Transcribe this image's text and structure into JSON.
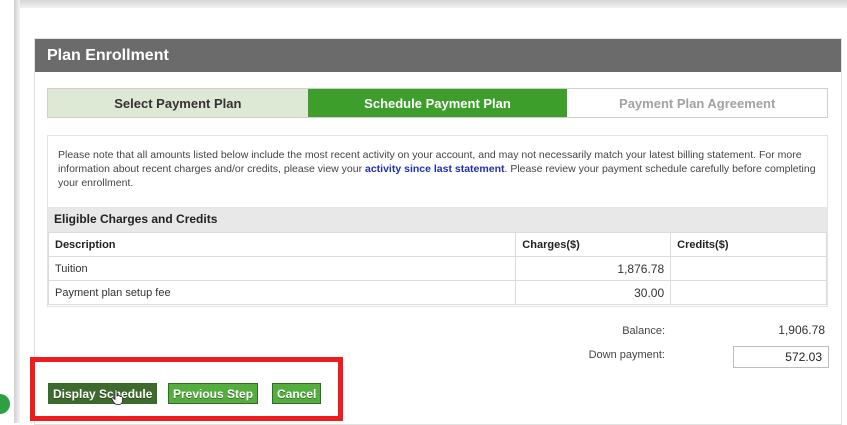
{
  "panel": {
    "title": "Plan Enrollment"
  },
  "steps": [
    {
      "label": "Select Payment Plan",
      "state": "done"
    },
    {
      "label": "Schedule Payment Plan",
      "state": "active"
    },
    {
      "label": "Payment Plan Agreement",
      "state": "todo"
    }
  ],
  "notice": {
    "text_before": "Please note that all amounts listed below include the most recent activity on your account, and may not necessarily match your latest billing statement. For more information about recent charges and/or credits, please view your ",
    "link_text": "activity since last statement",
    "text_after": ". Please review your payment schedule carefully before completing your enrollment."
  },
  "section": {
    "title": "Eligible Charges and Credits"
  },
  "table": {
    "headers": [
      "Description",
      "Charges($)",
      "Credits($)"
    ],
    "rows": [
      {
        "description": "Tuition",
        "charges": "1,876.78",
        "credits": ""
      },
      {
        "description": "Payment plan setup fee",
        "charges": "30.00",
        "credits": ""
      }
    ]
  },
  "summary": {
    "balance_label": "Balance:",
    "balance_value": "1,906.78",
    "down_payment_label": "Down payment:",
    "down_payment_value": "572.03"
  },
  "buttons": {
    "display_schedule": "Display Schedule",
    "previous_step": "Previous Step",
    "cancel": "Cancel"
  },
  "colors": {
    "header_bg": "#6b6b6b",
    "step_active": "#3d9e2b",
    "step_done": "#dde9d4",
    "link": "#1f2fb0",
    "highlight_border": "#ee1c1c",
    "button_dark": "#3e6a2d",
    "button_green": "#55ad3f"
  }
}
